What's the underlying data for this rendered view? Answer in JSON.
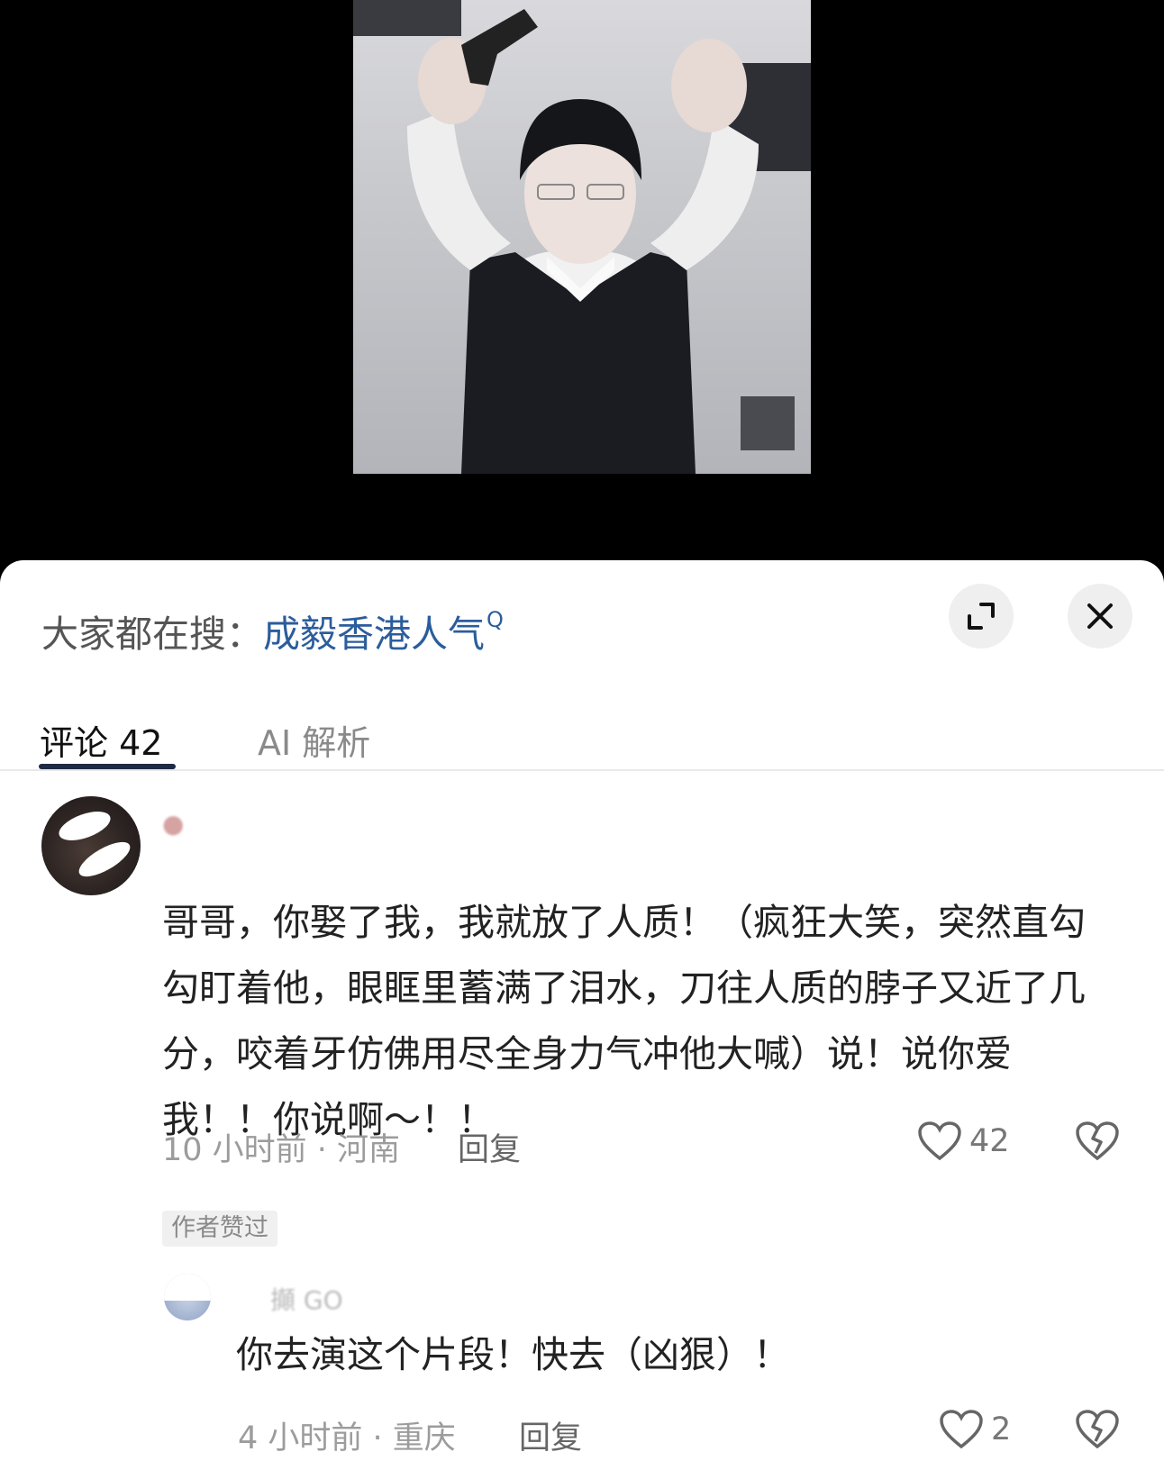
{
  "search_bar": {
    "prefix": "大家都在搜：",
    "term": "成毅香港人气",
    "expand_icon": "expand-icon",
    "close_icon": "close-icon"
  },
  "tabs": [
    {
      "label": "评论 42",
      "active": true
    },
    {
      "label": "AI 解析",
      "active": false
    }
  ],
  "comments": [
    {
      "text": "哥哥，你娶了我，我就放了人质！（疯狂大笑，突然直勾勾盯着他，眼眶里蓄满了泪水，刀往人质的脖子又近了几分，咬着牙仿佛用尽全身力气冲他大喊）说！说你爱我！！你说啊～！！",
      "meta": "10 小时前 · 河南",
      "reply_label": "回复",
      "likes": "42",
      "badge": "作者赞过",
      "like_icon": "heart-outline-icon",
      "dislike_icon": "broken-heart-icon",
      "reply": {
        "author_partial": "攧 GO",
        "text": "你去演这个片段！快去（凶狠）！",
        "meta": "4 小时前 · 重庆",
        "reply_label": "回复",
        "likes": "2"
      }
    }
  ],
  "colors": {
    "search_term": "#2b5d9c",
    "tab_underline": "#1f2a44",
    "background_top": "#000000"
  }
}
